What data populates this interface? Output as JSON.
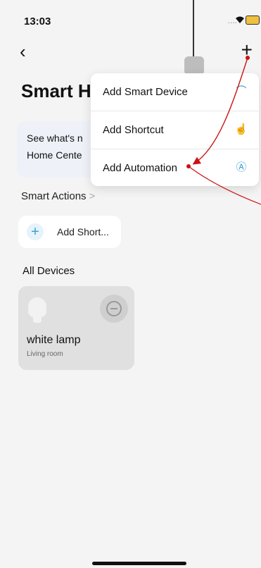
{
  "status_bar": {
    "time": "13:03",
    "signal": "....",
    "wifi_icon": "wifi-icon",
    "battery_icon": "battery-icon"
  },
  "nav": {
    "back_icon": "chevron-left-icon",
    "add_icon": "plus-icon",
    "back_glyph": "‹",
    "add_glyph": "+"
  },
  "page": {
    "title": "Smart H"
  },
  "banner": {
    "line1": "See what's n",
    "line2": "Home Cente"
  },
  "smart_actions": {
    "label": "Smart Actions",
    "chevron": ">"
  },
  "add_shortcut_card": {
    "plus": "+",
    "label": "Add Short..."
  },
  "all_devices": {
    "label": "All Devices"
  },
  "device": {
    "name": "white lamp",
    "room": "Living room"
  },
  "dropdown_menu": {
    "items": [
      {
        "label": "Add Smart Device",
        "icon": "router-icon",
        "glyph": "⌒"
      },
      {
        "label": "Add Shortcut",
        "icon": "tap-hand-icon",
        "glyph": "☝"
      },
      {
        "label": "Add Automation",
        "icon": "automation-icon",
        "glyph": "Ⓐ"
      }
    ]
  },
  "colors": {
    "accent": "#3aa0d8",
    "annotation": "#cc1111",
    "background": "#f4f4f4"
  }
}
